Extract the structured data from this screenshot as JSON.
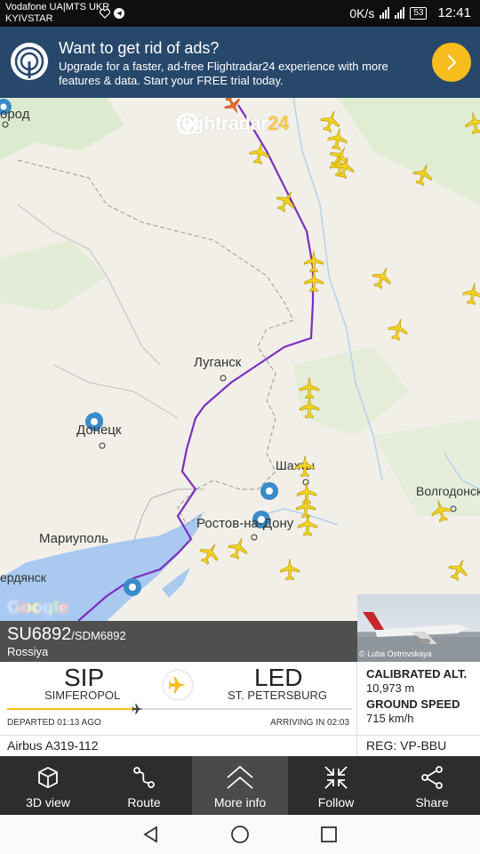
{
  "status_bar": {
    "carrier_line1": "Vodafone UA|MTS UKR",
    "carrier_line2": "KYIVSTAR",
    "speed": "0K/s",
    "battery": "53",
    "time": "12:41"
  },
  "ad": {
    "title": "Want to get rid of ads?",
    "text": "Upgrade for a faster, ad-free Flightradar24 experience with more features & data. Start your FREE trial today.",
    "accent_color": "#f6bd1c",
    "background_color": "#27486b"
  },
  "map": {
    "brand": "flightradar",
    "brand_num": "24",
    "google_logo": "Google",
    "cities": {
      "gorod": "ород",
      "lugansk": "Луганск",
      "donetsk": "Донецк",
      "shakhty": "Шахты",
      "rostov": "Ростов-на-Дону",
      "mariupol": "Мариуполь",
      "berdyansk": "ердянск",
      "volgodonsk": "Волгодонск"
    },
    "route_color": "#7b2fbe",
    "plane_color": "#f4d21f"
  },
  "flight": {
    "callsign": "SU6892",
    "callsign_alt": "/SDM6892",
    "airline": "Rossiya",
    "photo_credit": "© Luba Ostrovskaya",
    "origin_code": "SIP",
    "origin_city": "SIMFEROPOL",
    "dest_code": "LED",
    "dest_city": "ST. PETERSBURG",
    "departed": "DEPARTED 01:13 AGO",
    "arriving": "ARRIVING IN 02:03",
    "progress_fraction": 0.37,
    "alt_label": "CALIBRATED ALT.",
    "alt_value": "10,973 m",
    "speed_label": "GROUND SPEED",
    "speed_value": "715 km/h",
    "aircraft": "Airbus A319-112",
    "reg": "REG: VP-BBU"
  },
  "toolbar": {
    "view3d": "3D view",
    "route": "Route",
    "more_info": "More info",
    "follow": "Follow",
    "share": "Share"
  }
}
